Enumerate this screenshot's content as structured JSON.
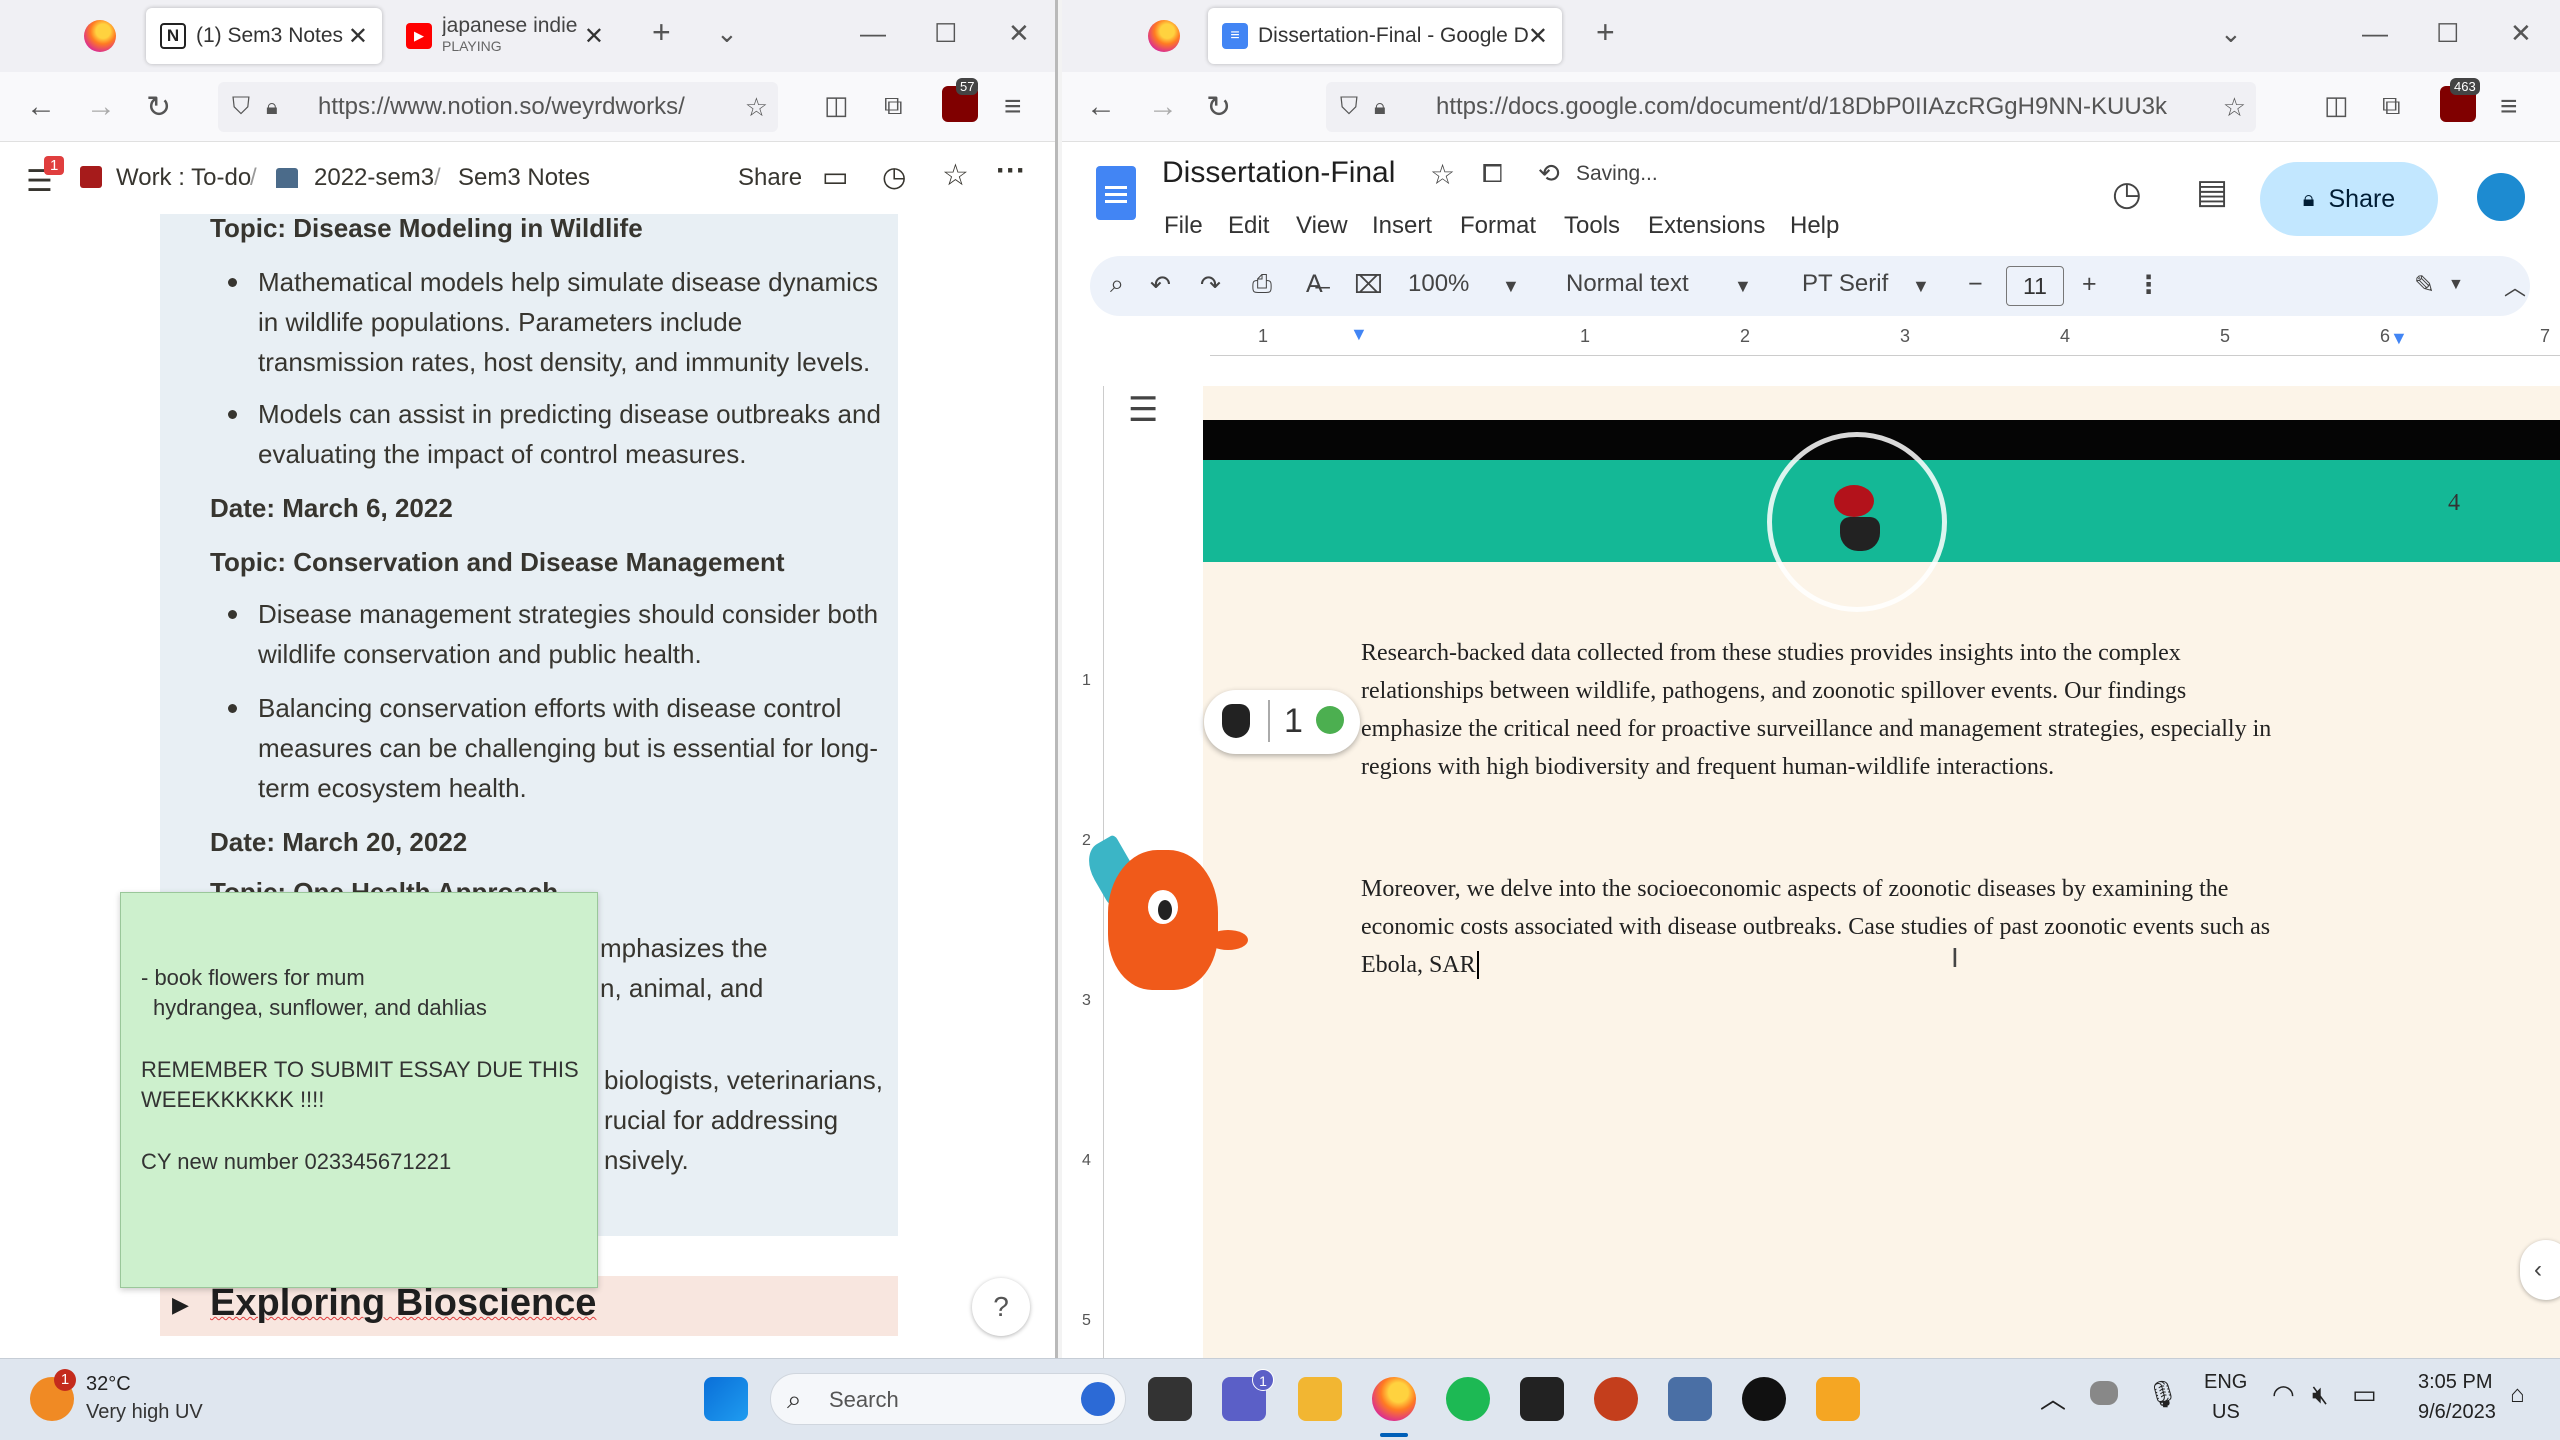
{
  "left_window": {
    "tabs": [
      {
        "title": "(1) Sem3 Notes",
        "icon": "notion-icon"
      },
      {
        "title": "japanese indie r",
        "subtitle": "PLAYING",
        "icon": "youtube-icon"
      }
    ],
    "url": "https://www.notion.so/weyrdworks/",
    "badge_count": "57",
    "notion": {
      "notification_count": "1",
      "breadcrumb": [
        "Work : To-do",
        "2022-sem3",
        "Sem3 Notes"
      ],
      "share_label": "Share",
      "blocks": [
        {
          "type": "heading",
          "text": "Topic: Disease Modeling in Wildlife"
        },
        {
          "type": "bullet",
          "lines": [
            "Mathematical models help simulate disease dynamics",
            "in wildlife populations. Parameters include",
            "transmission rates, host density, and immunity levels."
          ]
        },
        {
          "type": "bullet",
          "lines": [
            "Models can assist in predicting disease outbreaks and",
            "evaluating the impact of control measures."
          ]
        },
        {
          "type": "heading",
          "text": "Date: March 6, 2022"
        },
        {
          "type": "heading",
          "text": "Topic: Conservation and Disease Management"
        },
        {
          "type": "bullet",
          "lines": [
            "Disease management strategies should consider both",
            "wildlife conservation and public health."
          ]
        },
        {
          "type": "bullet",
          "lines": [
            "Balancing conservation efforts with disease control",
            "measures can be challenging but is essential for long-",
            "term ecosystem health."
          ]
        },
        {
          "type": "heading",
          "text": "Date: March 20, 2022"
        },
        {
          "type": "heading",
          "text": "Topic: One Health Approach"
        }
      ],
      "partial_lines": [
        "mphasizes the",
        "n, animal, and",
        "biologists, veterinarians,",
        "rucial for addressing",
        "nsively."
      ],
      "toggle_heading": "Exploring Bioscience",
      "help_label": "?"
    },
    "sticky_note": [
      "- book flowers for mum",
      "  hydrangea, sunflower, and dahlias",
      "REMEMBER TO SUBMIT ESSAY DUE THIS",
      "WEEEKKKKKK !!!!",
      "CY new number 023345671221"
    ]
  },
  "right_window": {
    "tabs": [
      {
        "title": "Dissertation-Final - Google Doc",
        "icon": "docs-icon"
      }
    ],
    "url": "https://docs.google.com/document/d/18DbP0IIAzcRGgH9NN-KUU3k",
    "badge_count": "463",
    "docs": {
      "title": "Dissertation-Final",
      "save_status": "Saving...",
      "share_label": "Share",
      "menu": [
        "File",
        "Edit",
        "View",
        "Insert",
        "Format",
        "Tools",
        "Extensions",
        "Help"
      ],
      "zoom": "100%",
      "style": "Normal text",
      "font": "PT Serif",
      "font_size": "11",
      "ruler_numbers": [
        "1",
        "1",
        "2",
        "3",
        "4",
        "5",
        "6",
        "7"
      ],
      "vertical_ruler_numbers": [
        "1",
        "2",
        "3",
        "4",
        "5"
      ],
      "page_number": "4",
      "widget_count": "1",
      "paragraph1": [
        "Research-backed data collected from these studies provides insights into the complex",
        "relationships between wildlife, pathogens, and zoonotic spillover events. Our findings",
        "emphasize the critical need for proactive surveillance and management strategies, especially in",
        "regions with high biodiversity and frequent human-wildlife interactions."
      ],
      "paragraph2": [
        "Moreover, we delve into the socioeconomic aspects of zoonotic diseases by examining the",
        "economic costs associated with disease outbreaks. Case studies of past zoonotic events such as",
        "Ebola, SAR"
      ]
    }
  },
  "taskbar": {
    "weather_temp": "32°C",
    "weather_desc": "Very high UV",
    "weather_badge": "1",
    "search_placeholder": "Search",
    "teams_badge": "1",
    "lang": "ENG",
    "region": "US",
    "time": "3:05 PM",
    "date": "9/6/2023"
  },
  "colors": {
    "docs_blue": "#4285f4",
    "share_bg": "#c2e7ff",
    "teal_banner": "#14b896",
    "page_bg": "#fcf4e8",
    "notion_block_bg": "#e8eff4",
    "sticky_bg": "#cdf0cd"
  }
}
